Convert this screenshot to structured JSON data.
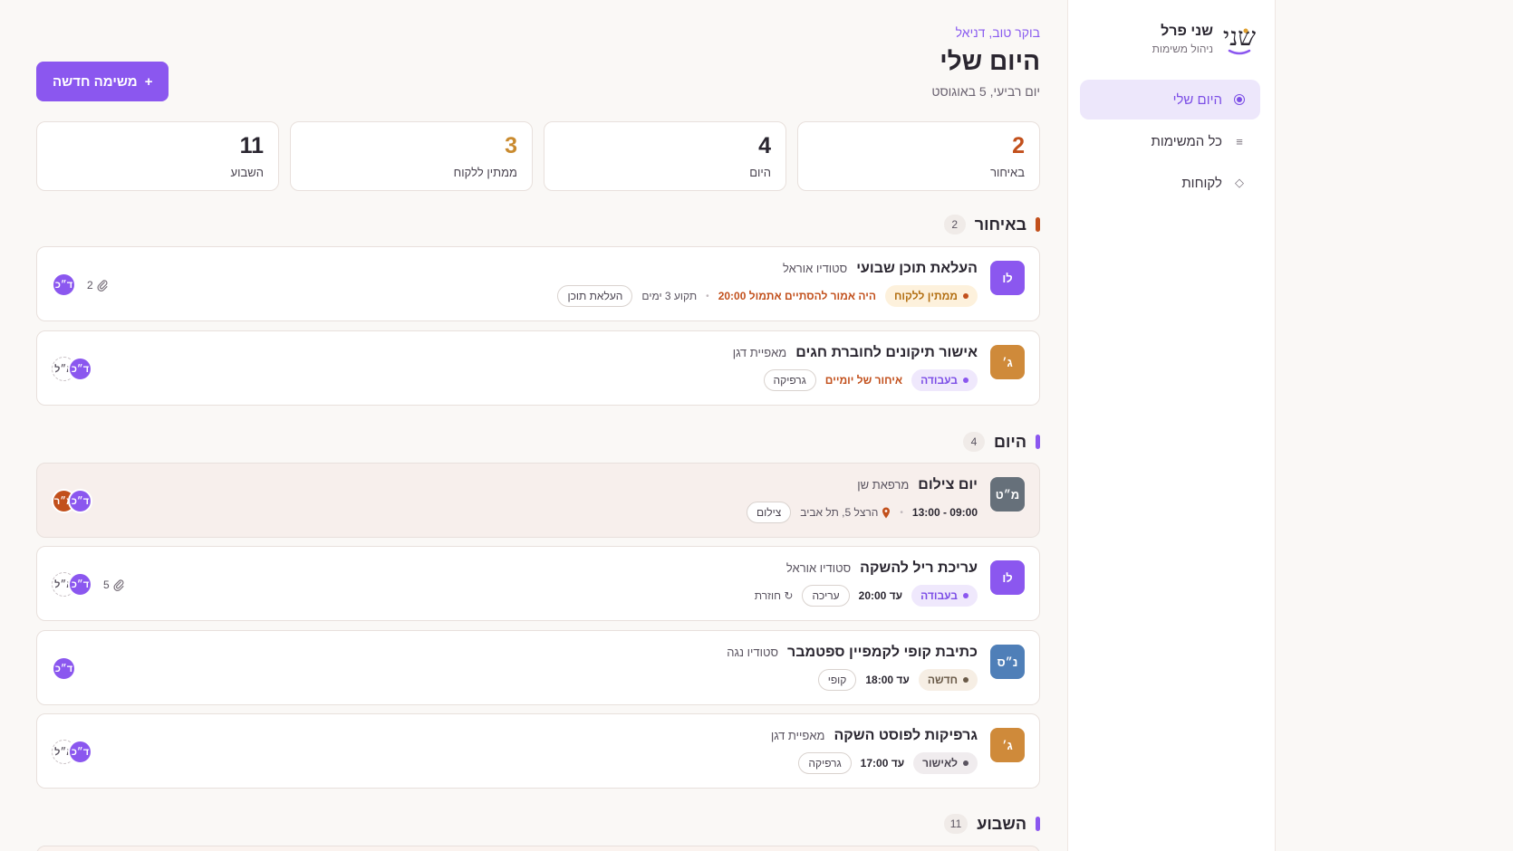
{
  "brand": {
    "name": "שני פרל",
    "subtitle": "ניהול משימות",
    "logo_text": "שני"
  },
  "nav": {
    "items": [
      {
        "label": "היום שלי",
        "icon": "radio-dot-icon",
        "active": true
      },
      {
        "label": "כל המשימות",
        "icon": "list-icon"
      },
      {
        "label": "לקוחות",
        "icon": "diamond-icon"
      }
    ]
  },
  "header": {
    "greeting": "בוקר טוב, דניאל",
    "title": "היום שלי",
    "date": "יום רביעי, 5 באוגוסט",
    "new_task_label": "משימה חדשה",
    "new_task_icon": "+"
  },
  "stats": [
    {
      "value": "2",
      "label": "באיחור",
      "color": "#c2501c"
    },
    {
      "value": "4",
      "label": "היום",
      "color": "#2a2630"
    },
    {
      "value": "3",
      "label": "ממתין ללקוח",
      "color": "#c98a2e"
    },
    {
      "value": "11",
      "label": "השבוע",
      "color": "#2a2630"
    }
  ],
  "sections": {
    "overdue": {
      "title": "באיחור",
      "count": "2",
      "color": "#c2501c"
    },
    "today": {
      "title": "היום",
      "count": "4",
      "color": "#8b57ef"
    },
    "week": {
      "title": "השבוע",
      "count": "11",
      "color": "#8b57ef"
    }
  },
  "tasks": [
    {
      "title": "העלאת תוכן שבועי",
      "client": "סטודיו אוראל",
      "client_initials": "לו",
      "client_color": "#8b57ef",
      "status": "ממתין ללקוח",
      "status_bg": "#fdf1dc",
      "status_fg": "#b36f12",
      "status_dot": "#c2501c",
      "warn": "היה אמור להסתיים אתמול 20:00",
      "meta": "תקוע 3 ימים",
      "tag": "העלאת תוכן",
      "attachments": "2",
      "people": [
        "ד״כ"
      ]
    },
    {
      "title": "אישור תיקונים לחוברת חגים",
      "client": "מאפיית דגן",
      "client_initials": "ג׳",
      "client_color": "#cf8a3a",
      "status": "בעבודה",
      "status_bg": "#efe8fc",
      "status_fg": "#7c4ee6",
      "status_dot": "#8b57ef",
      "warn": "איחור של יומיים",
      "tag": "גרפיקה",
      "people": [
        "ד״כ",
        "א״ל"
      ]
    },
    {
      "title": "יום צילום",
      "client": "מרפאת שן",
      "client_initials": "מ״ט",
      "client_color": "#66707a",
      "time": "09:00 - 13:00",
      "location": "הרצל 5, תל אביב",
      "tag": "צילום",
      "people": [
        "ד״כ",
        "מ״ר"
      ]
    },
    {
      "title": "עריכת ריל להשקה",
      "client": "סטודיו אוראל",
      "client_initials": "לו",
      "client_color": "#8b57ef",
      "status": "בעבודה",
      "status_bg": "#efe8fc",
      "status_fg": "#7c4ee6",
      "status_dot": "#8b57ef",
      "due": "עד 20:00",
      "tag": "עריכה",
      "recurring": "חוזרת",
      "attachments": "5",
      "people": [
        "ד״כ",
        "א״ל"
      ]
    },
    {
      "title": "כתיבת קופי לקמפיין ספטמבר",
      "client": "סטודיו נגה",
      "client_initials": "נ״ס",
      "client_color": "#4f7fb8",
      "status": "חדשה",
      "status_bg": "#f6eee4",
      "status_fg": "#6a5a48",
      "status_dot": "#6a5a48",
      "due": "עד 18:00",
      "tag": "קופי",
      "people": [
        "ד״כ"
      ]
    },
    {
      "title": "גרפיקות לפוסט השקה",
      "client": "מאפיית דגן",
      "client_initials": "ג׳",
      "client_color": "#cf8a3a",
      "status": "לאישור",
      "status_bg": "#f0ecee",
      "status_fg": "#4a4450",
      "status_dot": "#5a5460",
      "due": "עד 17:00",
      "tag": "גרפיקה",
      "people": [
        "ד״כ",
        "א״ל"
      ]
    }
  ],
  "colors": {
    "accent": "#8b57ef",
    "warn": "#c2501c",
    "person_dk": "#8b57ef",
    "person_mr": "#c2501c"
  }
}
